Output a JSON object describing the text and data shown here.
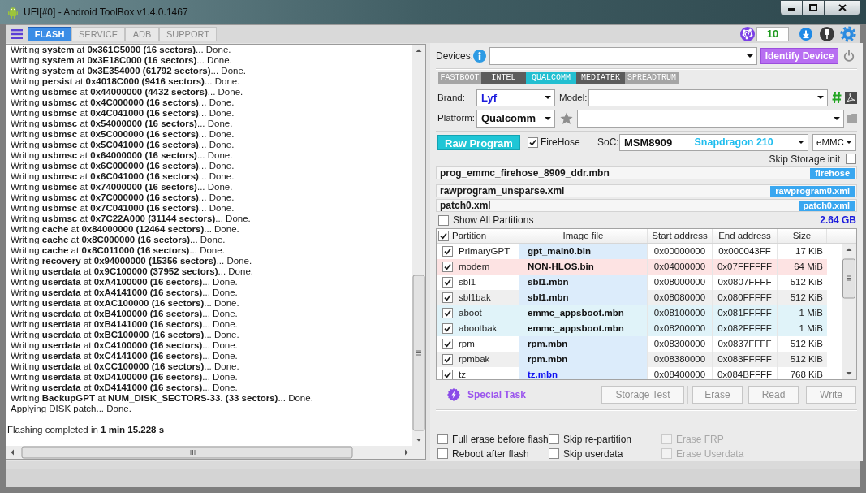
{
  "window": {
    "title": "UFI[#0] - Android ToolBox v1.4.0.1467"
  },
  "tabs": [
    {
      "label": "FLASH",
      "selected": true
    },
    {
      "label": "SERVICE",
      "selected": false
    },
    {
      "label": "ADB",
      "selected": false
    },
    {
      "label": "SUPPORT",
      "selected": false
    }
  ],
  "toolbar": {
    "count": "10"
  },
  "log": {
    "lines": [
      "Writing **system** at **0x361C5000 (16 sectors)**... Done.",
      "Writing **system** at **0x3E18C000 (16 sectors)**... Done.",
      "Writing **system** at **0x3E354000 (61792 sectors)**... Done.",
      "Writing **persist** at **0x4018C000 (9416 sectors)**... Done.",
      "Writing **usbmsc** at **0x44000000 (4432 sectors)**... Done.",
      "Writing **usbmsc** at **0x4C000000 (16 sectors)**... Done.",
      "Writing **usbmsc** at **0x4C041000 (16 sectors)**... Done.",
      "Writing **usbmsc** at **0x54000000 (16 sectors)**... Done.",
      "Writing **usbmsc** at **0x5C000000 (16 sectors)**... Done.",
      "Writing **usbmsc** at **0x5C041000 (16 sectors)**... Done.",
      "Writing **usbmsc** at **0x64000000 (16 sectors)**... Done.",
      "Writing **usbmsc** at **0x6C000000 (16 sectors)**... Done.",
      "Writing **usbmsc** at **0x6C041000 (16 sectors)**... Done.",
      "Writing **usbmsc** at **0x74000000 (16 sectors)**... Done.",
      "Writing **usbmsc** at **0x7C000000 (16 sectors)**... Done.",
      "Writing **usbmsc** at **0x7C041000 (16 sectors)**... Done.",
      "Writing **usbmsc** at **0x7C22A000 (31144 sectors)**... Done.",
      "Writing **cache** at **0x84000000 (12464 sectors)**... Done.",
      "Writing **cache** at **0x8C000000 (16 sectors)**... Done.",
      "Writing **cache** at **0x8C011000 (16 sectors)**... Done.",
      "Writing **recovery** at **0x94000000 (15356 sectors)**... Done.",
      "Writing **userdata** at **0x9C100000 (37952 sectors)**... Done.",
      "Writing **userdata** at **0xA4100000 (16 sectors)**... Done.",
      "Writing **userdata** at **0xA4141000 (16 sectors)**... Done.",
      "Writing **userdata** at **0xAC100000 (16 sectors)**... Done.",
      "Writing **userdata** at **0xB4100000 (16 sectors)**... Done.",
      "Writing **userdata** at **0xB4141000 (16 sectors)**... Done.",
      "Writing **userdata** at **0xBC100000 (16 sectors)**... Done.",
      "Writing **userdata** at **0xC4100000 (16 sectors)**... Done.",
      "Writing **userdata** at **0xC4141000 (16 sectors)**... Done.",
      "Writing **userdata** at **0xCC100000 (16 sectors)**... Done.",
      "Writing **userdata** at **0xD4100000 (16 sectors)**... Done.",
      "Writing **userdata** at **0xD4141000 (16 sectors)**... Done.",
      "Writing **BackupGPT** at **NUM_DISK_SECTORS-33. (33 sectors)**... Done.",
      "Applying DISK patch... Done."
    ],
    "summary": "Flashing completed in **1 min 15.228 s**"
  },
  "devices": {
    "label": "Devices:",
    "button": "Identify Device"
  },
  "platform_tabs": [
    {
      "label": "FASTBOOT",
      "selected": false
    },
    {
      "label": "INTEL",
      "selected": false
    },
    {
      "label": "QUALCOMM",
      "selected": true
    },
    {
      "label": "MEDIATEK",
      "selected": false
    },
    {
      "label": "SPREADTRUM",
      "selected": false
    }
  ],
  "brand": {
    "label": "Brand:",
    "value": "Lyf"
  },
  "model": {
    "label": "Model:"
  },
  "platform": {
    "label": "Platform:",
    "value": "Qualcomm"
  },
  "raw_program": {
    "label": "Raw Program"
  },
  "firehose": {
    "label": "FireHose",
    "checked": true
  },
  "soc": {
    "label": "SoC:",
    "value": "MSM8909",
    "detail": "Snapdragon 210"
  },
  "storage": {
    "value": "eMMC"
  },
  "skip_storage_init": {
    "label": "Skip Storage init",
    "checked": false
  },
  "files": [
    {
      "name": "prog_emmc_firehose_8909_ddr.mbn",
      "tag": "firehose"
    },
    {
      "name": "rawprogram_unsparse.xml",
      "tag": "rawprogram0.xml"
    },
    {
      "name": "patch0.xml",
      "tag": "patch0.xml"
    }
  ],
  "show_all_partitions": {
    "label": "Show All Partitions",
    "checked": false
  },
  "total_size": "2.64 GB",
  "table": {
    "select_all": {
      "checked": true
    },
    "columns": [
      "Partition",
      "Image file",
      "Start address",
      "End address",
      "Size"
    ],
    "rows": [
      {
        "checked": true,
        "partition": "PrimaryGPT",
        "image_file": "gpt_main0.bin",
        "start": "0x00000000",
        "end": "0x000043FF",
        "size": "17 KiB",
        "color": "#ffffff",
        "file_highlighted": false
      },
      {
        "checked": true,
        "partition": "modem",
        "image_file": "NON-HLOS.bin",
        "start": "0x04000000",
        "end": "0x07FFFFFF",
        "size": "64 MiB",
        "color": "#fde3e3",
        "file_highlighted": false
      },
      {
        "checked": true,
        "partition": "sbl1",
        "image_file": "sbl1.mbn",
        "start": "0x08000000",
        "end": "0x0807FFFF",
        "size": "512 KiB",
        "color": "#ffffff",
        "file_highlighted": false
      },
      {
        "checked": true,
        "partition": "sbl1bak",
        "image_file": "sbl1.mbn",
        "start": "0x08080000",
        "end": "0x080FFFFF",
        "size": "512 KiB",
        "color": "#efefef",
        "file_highlighted": false
      },
      {
        "checked": true,
        "partition": "aboot",
        "image_file": "emmc_appsboot.mbn",
        "start": "0x08100000",
        "end": "0x081FFFFF",
        "size": "1 MiB",
        "color": "#e0f3f9",
        "file_highlighted": false
      },
      {
        "checked": true,
        "partition": "abootbak",
        "image_file": "emmc_appsboot.mbn",
        "start": "0x08200000",
        "end": "0x082FFFFF",
        "size": "1 MiB",
        "color": "#e0f3f9",
        "file_highlighted": false
      },
      {
        "checked": true,
        "partition": "rpm",
        "image_file": "rpm.mbn",
        "start": "0x08300000",
        "end": "0x0837FFFF",
        "size": "512 KiB",
        "color": "#ffffff",
        "file_highlighted": false
      },
      {
        "checked": true,
        "partition": "rpmbak",
        "image_file": "rpm.mbn",
        "start": "0x08380000",
        "end": "0x083FFFFF",
        "size": "512 KiB",
        "color": "#efefef",
        "file_highlighted": false
      },
      {
        "checked": true,
        "partition": "tz",
        "image_file": "tz.mbn",
        "start": "0x08400000",
        "end": "0x084BFFFF",
        "size": "768 KiB",
        "color": "#ffffff",
        "file_highlighted": true
      }
    ]
  },
  "special_task": {
    "label": "Special Task"
  },
  "actions": [
    {
      "label": "Storage Test",
      "disabled": true
    },
    {
      "label": "Erase",
      "disabled": true
    },
    {
      "label": "Read",
      "disabled": true
    },
    {
      "label": "Write",
      "disabled": true
    }
  ],
  "options": [
    {
      "label": "Full erase before flash",
      "checked": false,
      "disabled": false
    },
    {
      "label": "Skip re-partition",
      "checked": false,
      "disabled": false
    },
    {
      "label": "Erase FRP",
      "checked": false,
      "disabled": true
    },
    {
      "label": "Reboot after flash",
      "checked": false,
      "disabled": false
    },
    {
      "label": "Skip userdata",
      "checked": false,
      "disabled": false
    },
    {
      "label": "Erase Userdata",
      "checked": false,
      "disabled": true
    }
  ]
}
